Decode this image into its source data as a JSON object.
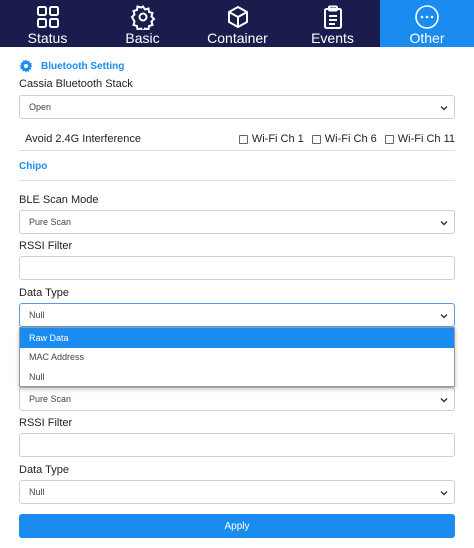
{
  "nav": {
    "tabs": [
      {
        "label": "Status",
        "icon": "grid-icon",
        "active": false
      },
      {
        "label": "Basic",
        "icon": "gear-icon",
        "active": false
      },
      {
        "label": "Container",
        "icon": "cube-icon",
        "active": false
      },
      {
        "label": "Events",
        "icon": "clipboard-icon",
        "active": false
      },
      {
        "label": "Other",
        "icon": "more-icon",
        "active": true
      }
    ]
  },
  "bluetooth": {
    "title": "Bluetooth Setting",
    "stack_label": "Cassia Bluetooth Stack",
    "stack_value": "Open",
    "interference_label": "Avoid 2.4G Interference",
    "wifi_options": [
      "Wi-Fi Ch 1",
      "Wi-Fi Ch 6",
      "Wi-Fi Ch 11"
    ]
  },
  "chipo": {
    "title": "Chipo",
    "scan_mode_label": "BLE Scan Mode",
    "scan_mode_value": "Pure Scan",
    "rssi_label": "RSSI Filter",
    "data_type_label": "Data Type",
    "data_type_value": "Null",
    "dropdown_options": [
      "Raw Data",
      "MAC Address",
      "Null"
    ]
  },
  "chipo2": {
    "scan_mode_value": "Pure Scan",
    "rssi_label": "RSSI Filter",
    "data_type_label": "Data Type",
    "data_type_value": "Null"
  },
  "apply_label": "Apply",
  "colors": {
    "nav_bg": "#1b1c4e",
    "accent": "#1a8cf0"
  }
}
